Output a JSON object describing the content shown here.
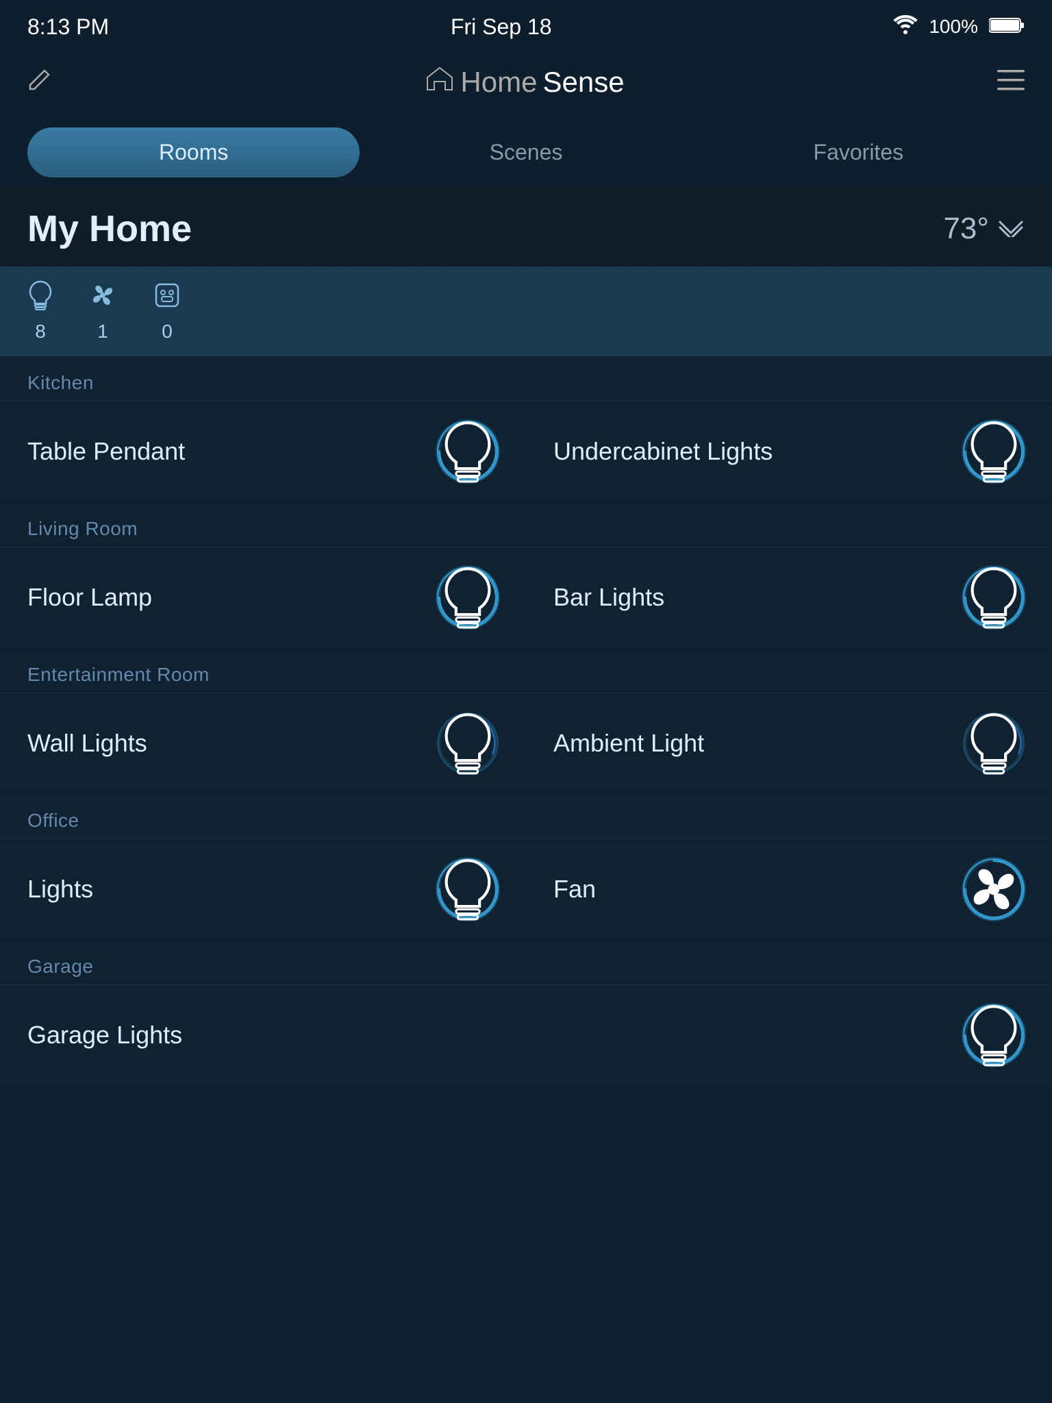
{
  "statusBar": {
    "time": "8:13 PM",
    "date": "Fri Sep 18",
    "wifi": "📶",
    "batteryPercent": "100%"
  },
  "topNav": {
    "pencilLabel": "✏",
    "logoHome": "Home",
    "logoSense": "Sense",
    "hamburgerLabel": "≡"
  },
  "tabs": [
    {
      "id": "rooms",
      "label": "Rooms",
      "active": true
    },
    {
      "id": "scenes",
      "label": "Scenes",
      "active": false
    },
    {
      "id": "favorites",
      "label": "Favorites",
      "active": false
    }
  ],
  "homeHeader": {
    "title": "My Home",
    "temp": "73°"
  },
  "deviceSummary": {
    "lights": {
      "count": "8",
      "icon": "💡"
    },
    "fans": {
      "count": "1",
      "icon": "🔗"
    },
    "outlets": {
      "count": "0",
      "icon": "🔌"
    }
  },
  "rooms": [
    {
      "id": "kitchen",
      "label": "Kitchen",
      "devices": [
        {
          "id": "table-pendant",
          "name": "Table Pendant",
          "type": "light",
          "state": "active"
        },
        {
          "id": "undercabinet-lights",
          "name": "Undercabinet Lights",
          "type": "light",
          "state": "active"
        }
      ]
    },
    {
      "id": "living-room",
      "label": "Living Room",
      "devices": [
        {
          "id": "floor-lamp",
          "name": "Floor Lamp",
          "type": "light",
          "state": "active"
        },
        {
          "id": "bar-lights",
          "name": "Bar Lights",
          "type": "light",
          "state": "active"
        }
      ]
    },
    {
      "id": "entertainment-room",
      "label": "Entertainment Room",
      "devices": [
        {
          "id": "wall-lights",
          "name": "Wall Lights",
          "type": "light",
          "state": "dim"
        },
        {
          "id": "ambient-light",
          "name": "Ambient Light",
          "type": "light",
          "state": "dim"
        }
      ]
    },
    {
      "id": "office",
      "label": "Office",
      "devices": [
        {
          "id": "lights",
          "name": "Lights",
          "type": "light",
          "state": "active"
        },
        {
          "id": "fan",
          "name": "Fan",
          "type": "fan",
          "state": "active"
        }
      ]
    },
    {
      "id": "garage",
      "label": "Garage",
      "devices": [
        {
          "id": "garage-lights",
          "name": "Garage Lights",
          "type": "light",
          "state": "active",
          "solo": true
        }
      ]
    }
  ]
}
